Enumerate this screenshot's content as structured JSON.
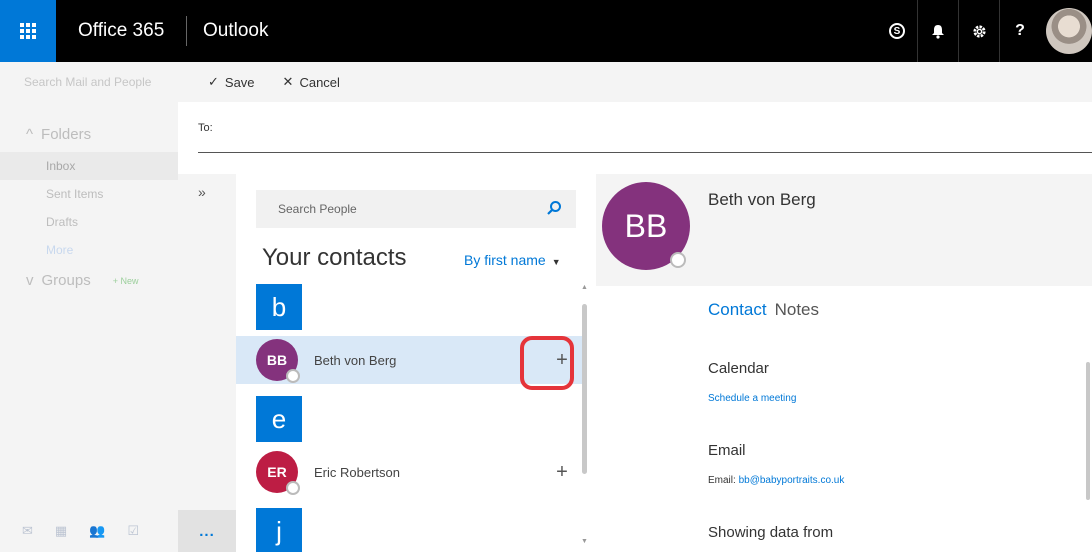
{
  "topbar": {
    "brand": "Office 365",
    "app": "Outlook",
    "icons": [
      "skype-icon",
      "bell-icon",
      "gear-icon",
      "help-icon"
    ],
    "skype_glyph": "S",
    "help_glyph": "?"
  },
  "leftnav": {
    "search_placeholder": "Search Mail and People",
    "folders_label": "Folders",
    "folders": [
      "Inbox",
      "Sent Items",
      "Drafts"
    ],
    "more_label": "More",
    "groups_label": "Groups",
    "new_label": "New"
  },
  "toolbar": {
    "save_label": "Save",
    "cancel_label": "Cancel"
  },
  "compose": {
    "to_label": "To:"
  },
  "people": {
    "expand_label": "»",
    "more_label": "...",
    "search_placeholder": "Search People",
    "title": "Your contacts",
    "sort_label": "By first name",
    "letters": [
      "b",
      "e",
      "j"
    ],
    "contacts": [
      {
        "initials": "BB",
        "name": "Beth von Berg",
        "color": "#84327d",
        "add": "+"
      },
      {
        "initials": "ER",
        "name": "Eric Robertson",
        "color": "#bd1d44",
        "add": "+"
      }
    ]
  },
  "detail": {
    "initials": "BB",
    "name": "Beth von Berg",
    "tab_contact": "Contact",
    "tab_notes": "Notes",
    "calendar_title": "Calendar",
    "calendar_link": "Schedule a meeting",
    "email_title": "Email",
    "email_label": "Email:",
    "email_value": "bb@babyportraits.co.uk",
    "source_title": "Showing data from"
  },
  "colors": {
    "accent": "#0078d7",
    "highlight": "#e5343a",
    "avatar_bb": "#84327d",
    "avatar_er": "#bd1d44"
  }
}
